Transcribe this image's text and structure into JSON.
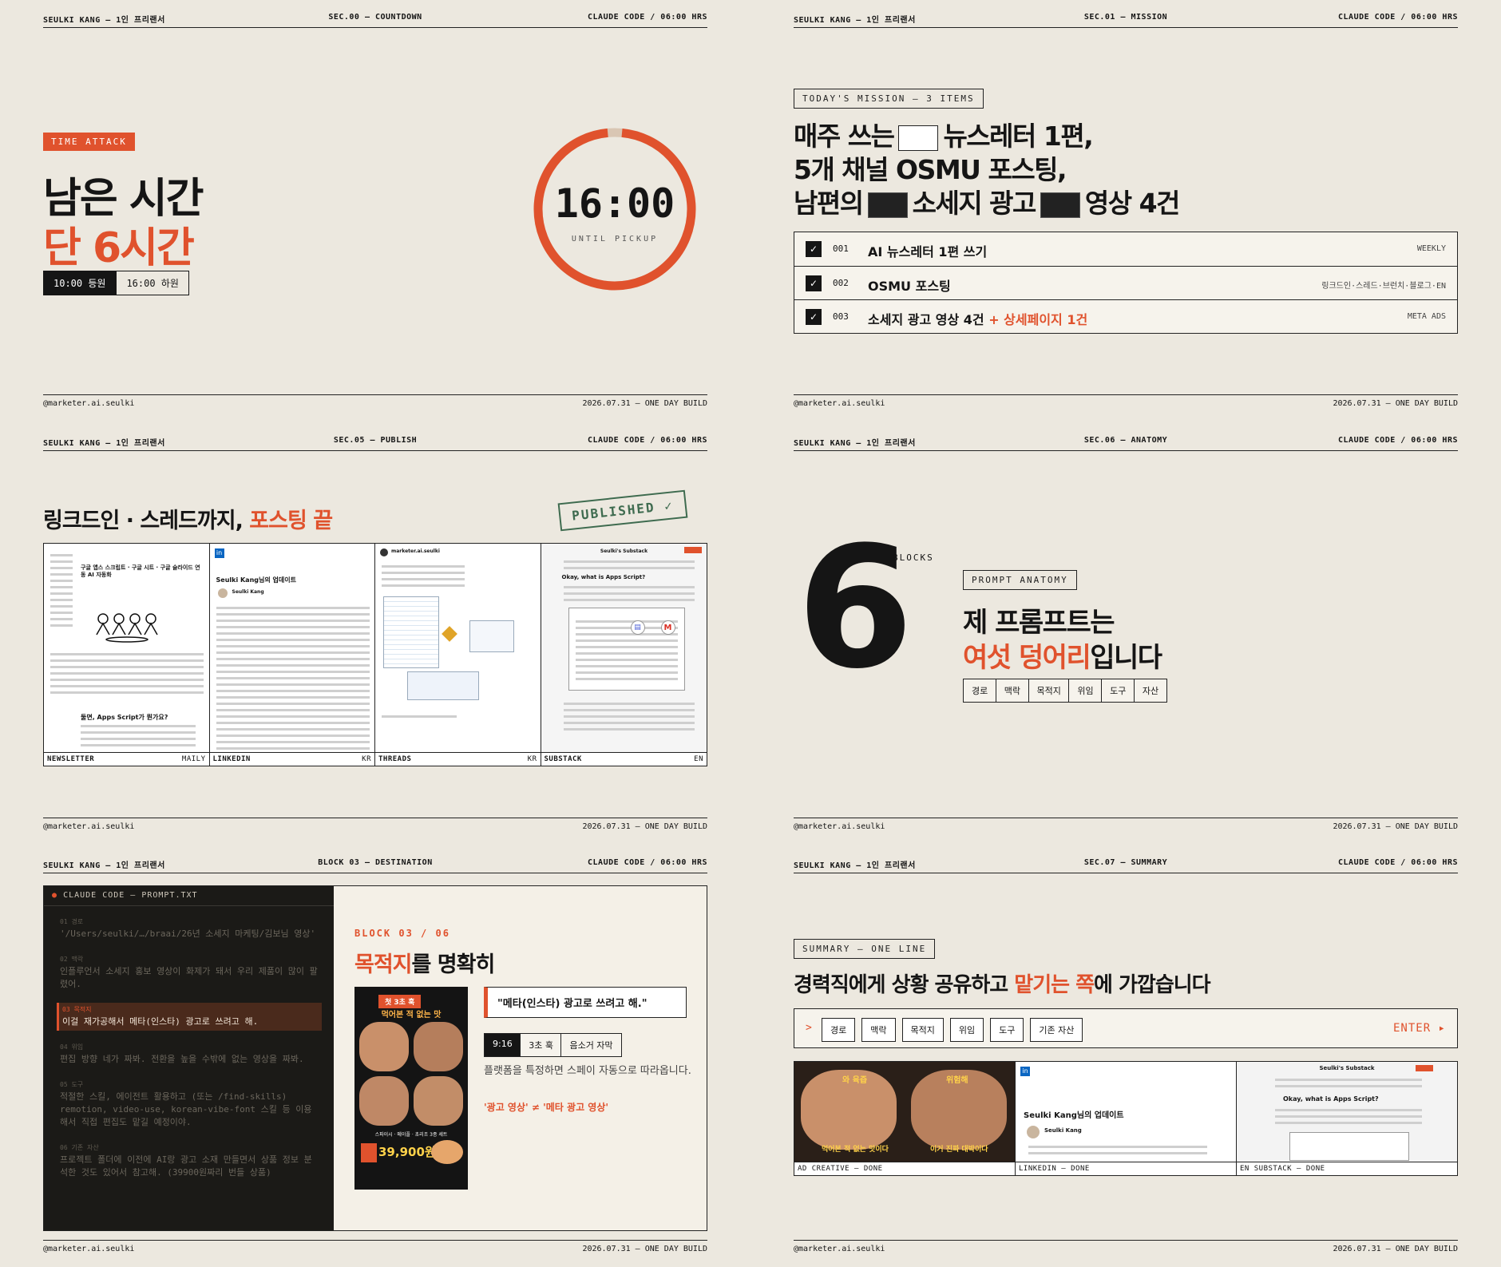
{
  "header": {
    "name": "SEULKI KANG — 1인 프리랜서",
    "right": "CLAUDE CODE / 06:00 HRS"
  },
  "footer": {
    "handle": "@marketer.ai.seulki",
    "date": "2026.07.31 — ONE DAY BUILD"
  },
  "countdown": {
    "section": "SEC.00 — COUNTDOWN",
    "tag": "TIME ATTACK",
    "title1": "남은 시간",
    "title2": "단 6시간",
    "start": "10:00 등원",
    "end": "16:00 하원",
    "time": "16:00",
    "until": "UNTIL PICKUP",
    "progress": 0.97
  },
  "mission": {
    "section": "SEC.01 — MISSION",
    "tag": "TODAY'S MISSION — 3 ITEMS",
    "line1a": "매주 쓰는",
    "line1b": "뉴스레터 1편,",
    "line2": "5개 채널 OSMU 포스팅,",
    "line3a": "남편의",
    "line3b": "소세지 광고",
    "line3c": "영상 4건",
    "items": [
      {
        "num": "001",
        "title": "AI 뉴스레터 1편 쓰기",
        "extra": "",
        "meta": "WEEKLY"
      },
      {
        "num": "002",
        "title": "OSMU 포스팅",
        "extra": "",
        "meta": "링크드인·스레드·브런치·블로그·EN"
      },
      {
        "num": "003",
        "title": "소세지 광고 영상 4건",
        "extra": "+ 상세페이지 1건",
        "meta": "META ADS"
      }
    ]
  },
  "publish": {
    "section": "SEC.05 — PUBLISH",
    "title_a": "링크드인 · 스레드까지,",
    "title_b": "포스팅 끝",
    "stamp": "PUBLISHED ✓",
    "channels": [
      {
        "name": "NEWSLETTER",
        "lang": "MAILY"
      },
      {
        "name": "LINKEDIN",
        "lang": "KR"
      },
      {
        "name": "THREADS",
        "lang": "KR"
      },
      {
        "name": "SUBSTACK",
        "lang": "EN"
      }
    ],
    "newsletter_head": "구글 앱스 스크립트 · 구글 시트 · 구글 슬라이드 연동 AI 자동화",
    "newsletter_q": "둘면, Apps Script가 뭔가요?",
    "linkedin_head": "Seulki Kang님의 업데이트",
    "linkedin_user": "Seulki Kang",
    "threads_user": "marketer.ai.seulki",
    "substack_head": "Seulki's Substack",
    "substack_q": "Okay, what is Apps Script?"
  },
  "anatomy": {
    "section": "SEC.06 — ANATOMY",
    "number": "6",
    "blocks_label": "BLOCKS",
    "tag": "PROMPT ANATOMY",
    "title1": "제 프롬프트는",
    "title2a": "여섯 덩어리",
    "title2b": "입니다",
    "chips": [
      "경로",
      "맥락",
      "목적지",
      "위임",
      "도구",
      "자산"
    ]
  },
  "destination": {
    "section": "BLOCK 03 — DESTINATION",
    "terminal_title": "CLAUDE CODE — PROMPT.TXT",
    "lines": [
      {
        "label": "01 경로",
        "text": "'/Users/seulki/…/braai/26년 소세지 마케팅/김보님 영상'"
      },
      {
        "label": "02 맥락",
        "text": "인플루언서 소세지 홍보 영상이 화제가 돼서 우리 제품이 많이 팔렸어."
      },
      {
        "label": "03 목적지",
        "text": "이걸 재가공해서 메타(인스타) 광고로 쓰려고 해."
      },
      {
        "label": "04 위임",
        "text": "편집 방향 네가 짜봐. 전환을 높을 수밖에 없는 영상을 짜봐."
      },
      {
        "label": "05 도구",
        "text": "적절한 스킬, 에이전트 활용하고 (또는 /find-skills) remotion, video-use, korean-vibe-font 스킬 등 이용해서 직접 편집도 맡길 예정이야."
      },
      {
        "label": "06 기존 자산",
        "text": "프로젝트 폴더에 이전에 AI랑 광고 소재 만들면서 상품 정보 분석한 것도 있어서 참고해. (39900원짜리 번들 상품)"
      }
    ],
    "block_label": "BLOCK 03 / 06",
    "title_a": "목적지",
    "title_b": "를 명확히",
    "quote": "\"메타(인스타) 광고로 쓰려고 해.\"",
    "specs": [
      "9:16",
      "3초 훅",
      "음소거 자막"
    ],
    "desc": "플랫폼을 특정하면 스페이 자동으로 따라옵니다.",
    "compare": "'광고 영상' ≠ '메타 광고 영상'",
    "ad_hook": "첫 3초 훅",
    "ad_line": "먹어본 적 없는 맛",
    "ad_product": "스파이시 · 메이플 · 초리조 3종 세트",
    "ad_price": "39,900원"
  },
  "summary": {
    "section": "SEC.07 — SUMMARY",
    "tag": "SUMMARY — ONE LINE",
    "title_a": "경력직에게 상황 공유하고",
    "title_b": "맡기는 쪽",
    "title_c": "에 가깝습니다",
    "prompt_symbol": ">",
    "chips": [
      "경로",
      "맥락",
      "목적지",
      "위임",
      "도구",
      "기존 자산"
    ],
    "enter": "ENTER ▸",
    "results": [
      "AD CREATIVE — DONE",
      "LINKEDIN — DONE",
      "EN SUBSTACK — DONE"
    ],
    "ad_sub1": "먹어본 적 없는 맛이다",
    "ad_sub2": "이거 진짜 대박이다",
    "ad_top1": "와 육즙",
    "ad_top2": "위험해",
    "linkedin_head": "Seulki Kang님의 업데이트",
    "linkedin_user": "Seulki Kang",
    "substack_head": "Seulki's Substack",
    "substack_q": "Okay, what is Apps Script?"
  },
  "colors": {
    "accent": "#e0522d",
    "ink": "#151515",
    "paper": "#ece8df",
    "terminal": "#1b1a17"
  }
}
